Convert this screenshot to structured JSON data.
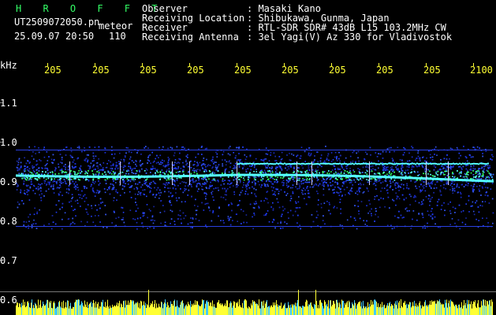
{
  "header": {
    "program": "H R O F F T",
    "filename": "UT2509072050.pn",
    "mode": "meteor",
    "datetime": "25.09.07 20:50",
    "count": "110",
    "info_rows": [
      {
        "label": "Observer",
        "value": ": Masaki Kano"
      },
      {
        "label": "Receiving Location",
        "value": ": Shibukawa, Gunma, Japan"
      },
      {
        "label": "Receiver",
        "value": ": RTL-SDR SDR# 43dB L15 103.2MHz CW"
      },
      {
        "label": "Receiving Antenna",
        "value": ": 3el Yagi(V) Az 330 for Vladivostok"
      }
    ]
  },
  "axes": {
    "y_unit": "kHz",
    "y_labels": [
      "1.1",
      "1.0",
      "0.9",
      "0.8",
      "0.7",
      "0.6"
    ],
    "time_labels": [
      "205",
      "205",
      "205",
      "205",
      "205",
      "205",
      "205",
      "205",
      "205",
      "2100"
    ]
  },
  "colors": {
    "background": "#000000",
    "text": "#ffffff",
    "accent_green": "#33ff66",
    "accent_yellow": "#ffff33",
    "noise_blue": "#1a2fd0",
    "signal_green": "#33ff66",
    "trace_cyan": "#55ffff"
  }
}
